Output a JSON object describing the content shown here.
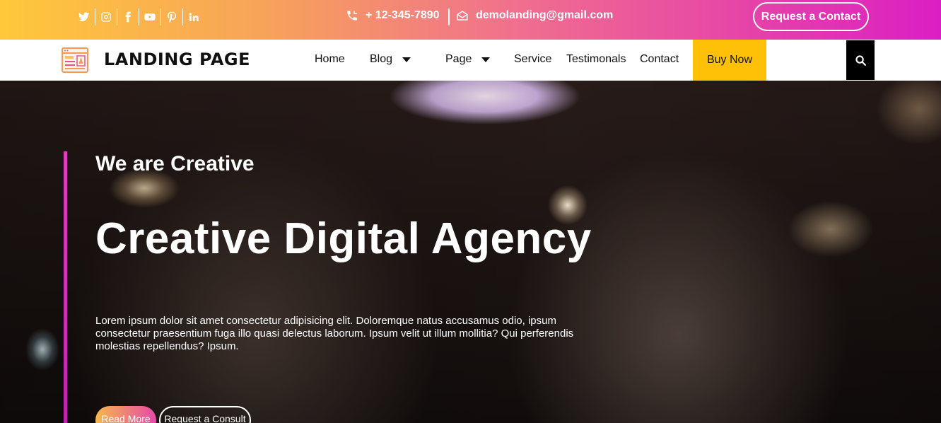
{
  "topbar": {
    "social_icons": [
      "twitter-icon",
      "instagram-icon",
      "facebook-icon",
      "youtube-icon",
      "pinterest-icon",
      "linkedin-icon"
    ],
    "phone": "+ 12-345-7890",
    "email": "demolanding@gmail.com",
    "request_button": "Request a Contact"
  },
  "nav": {
    "brand": "LANDING PAGE",
    "items": [
      {
        "label": "Home",
        "dropdown": false
      },
      {
        "label": "Blog",
        "dropdown": true
      },
      {
        "label": "Page",
        "dropdown": true
      },
      {
        "label": "Service",
        "dropdown": false
      },
      {
        "label": "Testimonals",
        "dropdown": false
      },
      {
        "label": "Contact",
        "dropdown": false
      }
    ],
    "buy_now": "Buy Now",
    "search_icon": "search-icon"
  },
  "hero": {
    "subtitle": "We are Creative",
    "title": "Creative Digital Agency",
    "text": "Lorem ipsum dolor sit amet consectetur adipisicing elit. Doloremque natus accusamus odio, ipsum consectetur praesentium fuga illo quasi delectus laborum. Ipsum velit ut illum mollitia? Qui perferendis molestias repellendus? Ipsum.",
    "read_more": "Read More",
    "consult": "Request a Consult"
  },
  "colors": {
    "gradient_start": "#ffc83a",
    "gradient_end": "#db1ec4",
    "buy_now_bg": "#ffc107",
    "accent_bar": "#e03cc0"
  }
}
